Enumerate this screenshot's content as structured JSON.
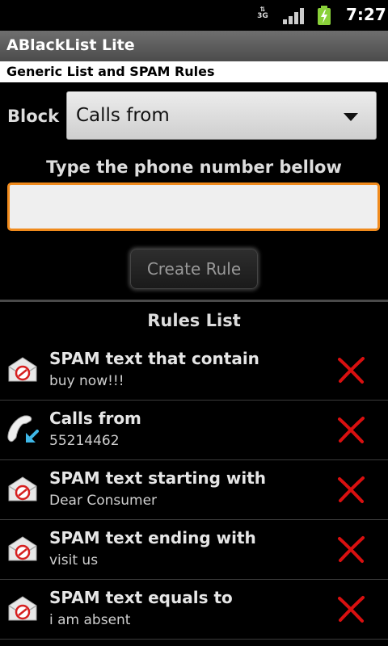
{
  "status": {
    "network": "3G",
    "time": "7:27"
  },
  "app_title": "ABlackList Lite",
  "subtitle": "Generic List and SPAM Rules",
  "form": {
    "block_label": "Block",
    "block_selected": "Calls from",
    "prompt": "Type the phone number bellow",
    "phone_value": "",
    "create_label": "Create Rule"
  },
  "rules_header": "Rules List",
  "rules": [
    {
      "type": "SPAM text that contain",
      "value": "buy now!!!",
      "icon": "sms-block-icon"
    },
    {
      "type": "Calls from",
      "value": "55214462",
      "icon": "phone-incoming-icon"
    },
    {
      "type": "SPAM text starting with",
      "value": "Dear Consumer",
      "icon": "sms-block-icon"
    },
    {
      "type": "SPAM text ending with",
      "value": "visit us",
      "icon": "sms-block-icon"
    },
    {
      "type": "SPAM text equals to",
      "value": "i am absent",
      "icon": "sms-block-icon"
    }
  ],
  "colors": {
    "accent_focus": "#f08a1c",
    "delete_red": "#d81010",
    "call_arrow": "#3fb8e8"
  }
}
